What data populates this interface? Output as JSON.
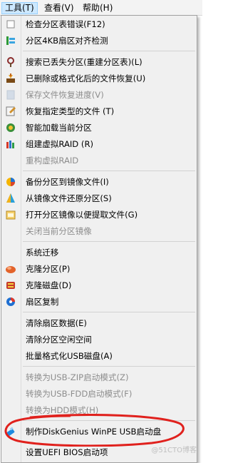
{
  "menubar": {
    "tools": "工具(T)",
    "view": "查看(V)",
    "help": "帮助(H)"
  },
  "menu_items": [
    {
      "label": "检查分区表错误(F12)",
      "icon": "check-partition-icon",
      "enabled": true
    },
    {
      "label": "分区4KB扇区对齐检测",
      "icon": "align-check-icon",
      "enabled": true
    },
    {
      "label": "搜索已丢失分区(重建分区表)(L)",
      "icon": "search-partition-icon",
      "enabled": true
    },
    {
      "label": "已删除或格式化后的文件恢复(U)",
      "icon": "file-recovery-icon",
      "enabled": true
    },
    {
      "label": "保存文件恢复进度(V)",
      "icon": "save-progress-icon",
      "enabled": false
    },
    {
      "label": "恢复指定类型的文件 (T)",
      "icon": "restore-type-icon",
      "enabled": true
    },
    {
      "label": "智能加载当前分区",
      "icon": "smart-load-icon",
      "enabled": true
    },
    {
      "label": "组建虚拟RAID (R)",
      "icon": "raid-icon",
      "enabled": true
    },
    {
      "label": "重构虚拟RAID",
      "icon": "",
      "enabled": false
    },
    {
      "label": "备份分区到镜像文件(I)",
      "icon": "backup-image-icon",
      "enabled": true
    },
    {
      "label": "从镜像文件还原分区(S)",
      "icon": "restore-image-icon",
      "enabled": true
    },
    {
      "label": "打开分区镜像以便提取文件(G)",
      "icon": "open-image-icon",
      "enabled": true
    },
    {
      "label": "关闭当前分区镜像",
      "icon": "",
      "enabled": false
    },
    {
      "label": "系统迁移",
      "icon": "",
      "enabled": true
    },
    {
      "label": "克隆分区(P)",
      "icon": "clone-partition-icon",
      "enabled": true
    },
    {
      "label": "克隆磁盘(D)",
      "icon": "clone-disk-icon",
      "enabled": true
    },
    {
      "label": "扇区复制",
      "icon": "sector-copy-icon",
      "enabled": true
    },
    {
      "label": "清除扇区数据(E)",
      "icon": "",
      "enabled": true
    },
    {
      "label": "清除分区空闲空间",
      "icon": "",
      "enabled": true
    },
    {
      "label": "批量格式化USB磁盘(A)",
      "icon": "",
      "enabled": true
    },
    {
      "label": "转换为USB-ZIP启动模式(Z)",
      "icon": "",
      "enabled": false
    },
    {
      "label": "转换为USB-FDD启动模式(F)",
      "icon": "",
      "enabled": false
    },
    {
      "label": "转换为HDD模式(H)",
      "icon": "",
      "enabled": false
    },
    {
      "label": "制作DiskGenius WinPE USB启动盘",
      "icon": "usb-winpe-icon",
      "enabled": true
    },
    {
      "label": "设置UEFI BIOS启动项",
      "icon": "",
      "enabled": true
    }
  ],
  "highlight_color": "#e0211d",
  "watermark": "@51CTO博客"
}
